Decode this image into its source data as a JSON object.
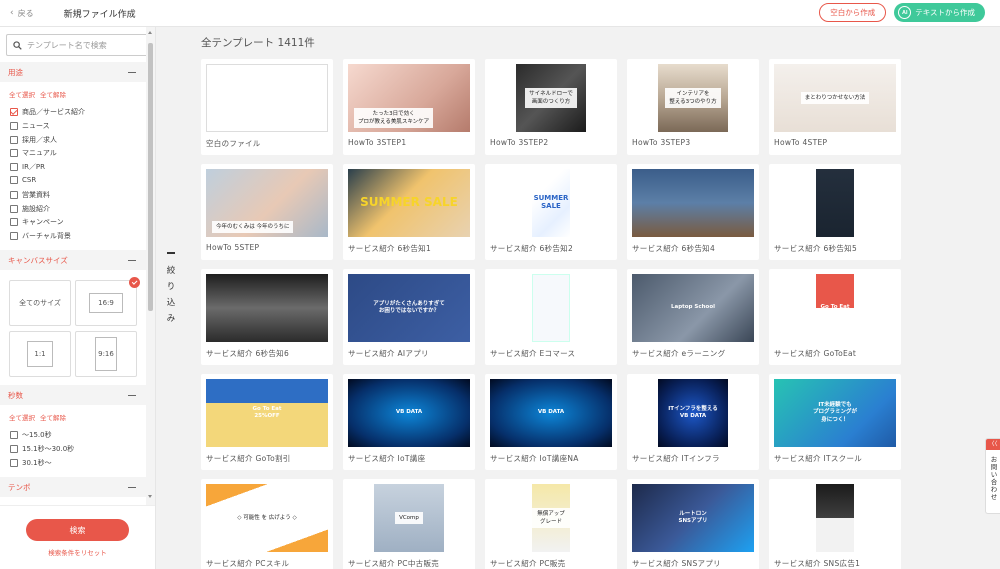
{
  "header": {
    "back_label": "戻る",
    "title": "新規ファイル作成",
    "btn_blank": "空白から作成",
    "btn_text": "テキストから作成",
    "ai_badge": "AI"
  },
  "sidebar": {
    "search_placeholder": "テンプレート名で検索",
    "purpose": {
      "title": "用途",
      "select_all": "全て選択",
      "clear_all": "全て解除",
      "items": [
        {
          "label": "商品／サービス紹介",
          "checked": true
        },
        {
          "label": "ニュース",
          "checked": false
        },
        {
          "label": "採用／求人",
          "checked": false
        },
        {
          "label": "マニュアル",
          "checked": false
        },
        {
          "label": "IR／PR",
          "checked": false
        },
        {
          "label": "CSR",
          "checked": false
        },
        {
          "label": "営業資料",
          "checked": false
        },
        {
          "label": "施設紹介",
          "checked": false
        },
        {
          "label": "キャンペーン",
          "checked": false
        },
        {
          "label": "バーチャル背景",
          "checked": false
        }
      ]
    },
    "canvas": {
      "title": "キャンバスサイズ",
      "sizes": [
        {
          "label": "全てのサイズ",
          "selected": false
        },
        {
          "label": "16:9",
          "selected": true
        },
        {
          "label": "1:1",
          "selected": false
        },
        {
          "label": "9:16",
          "selected": false
        }
      ]
    },
    "seconds": {
      "title": "秒数",
      "select_all": "全て選択",
      "clear_all": "全て解除",
      "items": [
        {
          "label": "～15.0秒",
          "checked": false
        },
        {
          "label": "15.1秒～30.0秒",
          "checked": false
        },
        {
          "label": "30.1秒～",
          "checked": false
        }
      ]
    },
    "tempo": {
      "title": "テンポ"
    },
    "search_button": "検索",
    "reset_link": "検索条件をリセット"
  },
  "filter_tab": {
    "chars": [
      "絞",
      "り",
      "込",
      "み"
    ]
  },
  "main": {
    "heading": "全テンプレート 1411件",
    "templates": [
      {
        "label": "空白のファイル",
        "style": "blank",
        "caption": ""
      },
      {
        "label": "HowTo 3STEP1",
        "style": "beauty",
        "caption": "たった3日で効く\nプロが教える美肌スキンケア"
      },
      {
        "label": "HowTo 3STEP2",
        "style": "dark",
        "caption": "サイネルドローで\n画面のつくり方"
      },
      {
        "label": "HowTo 3STEP3",
        "style": "room",
        "caption": "インテリアを\n整える3つのやり方"
      },
      {
        "label": "HowTo 4STEP",
        "style": "legs",
        "caption": "まとわりつかせない方法"
      },
      {
        "label": "HowTo 5STEP",
        "style": "face",
        "caption": "今年のむくみは 今年のうちに"
      },
      {
        "label": "サービス紹介 6秒告知1",
        "style": "summer",
        "caption": "SUMMER SALE"
      },
      {
        "label": "サービス紹介 6秒告知2",
        "style": "summer2",
        "caption": "SUMMER SALE"
      },
      {
        "label": "サービス紹介 6秒告知4",
        "style": "office",
        "caption": ""
      },
      {
        "label": "サービス紹介 6秒告知5",
        "style": "portrait",
        "caption": ""
      },
      {
        "label": "サービス紹介 6秒告知6",
        "style": "sky",
        "caption": ""
      },
      {
        "label": "サービス紹介 AIアプリ",
        "style": "ai",
        "caption": "アプリがたくさんありすぎて\nお困りではないですか？"
      },
      {
        "label": "サービス紹介 Eコマース",
        "style": "ecom",
        "caption": ""
      },
      {
        "label": "サービス紹介 eラーニング",
        "style": "laptop",
        "caption": "Laptop School"
      },
      {
        "label": "サービス紹介 GoToEat",
        "style": "gotoeat",
        "caption": "Go To Eat"
      },
      {
        "label": "サービス紹介 GoTo割引",
        "style": "gotodisc",
        "caption": "Go To Eat\n25%OFF"
      },
      {
        "label": "サービス紹介 IoT講座",
        "style": "vb",
        "caption": "VB DATA"
      },
      {
        "label": "サービス紹介 IoT講座NA",
        "style": "vb2",
        "caption": "VB DATA"
      },
      {
        "label": "サービス紹介 ITインフラ",
        "style": "infra",
        "caption": "ITインフラを整える\nVB DATA"
      },
      {
        "label": "サービス紹介 ITスクール",
        "style": "school",
        "caption": "IT未経験でも\nプログラミングが\n身につく！"
      },
      {
        "label": "サービス紹介 PCスキル",
        "style": "pcskill",
        "caption": "◇ 可能性 を 広げよう ◇"
      },
      {
        "label": "サービス紹介 PC中古販売",
        "style": "vcomp",
        "caption": "VComp"
      },
      {
        "label": "サービス紹介 PC販売",
        "style": "pcsale",
        "caption": "無償アップグレード"
      },
      {
        "label": "サービス紹介 SNSアプリ",
        "style": "sns",
        "caption": "ルートロン\nSNSアプリ"
      },
      {
        "label": "サービス紹介 SNS広告1",
        "style": "snsad",
        "caption": ""
      }
    ]
  },
  "contact": {
    "label": "お問い合わせ",
    "tab": "〈〈"
  },
  "colors": {
    "accent": "#e8574a",
    "green": "#3fc99a"
  }
}
